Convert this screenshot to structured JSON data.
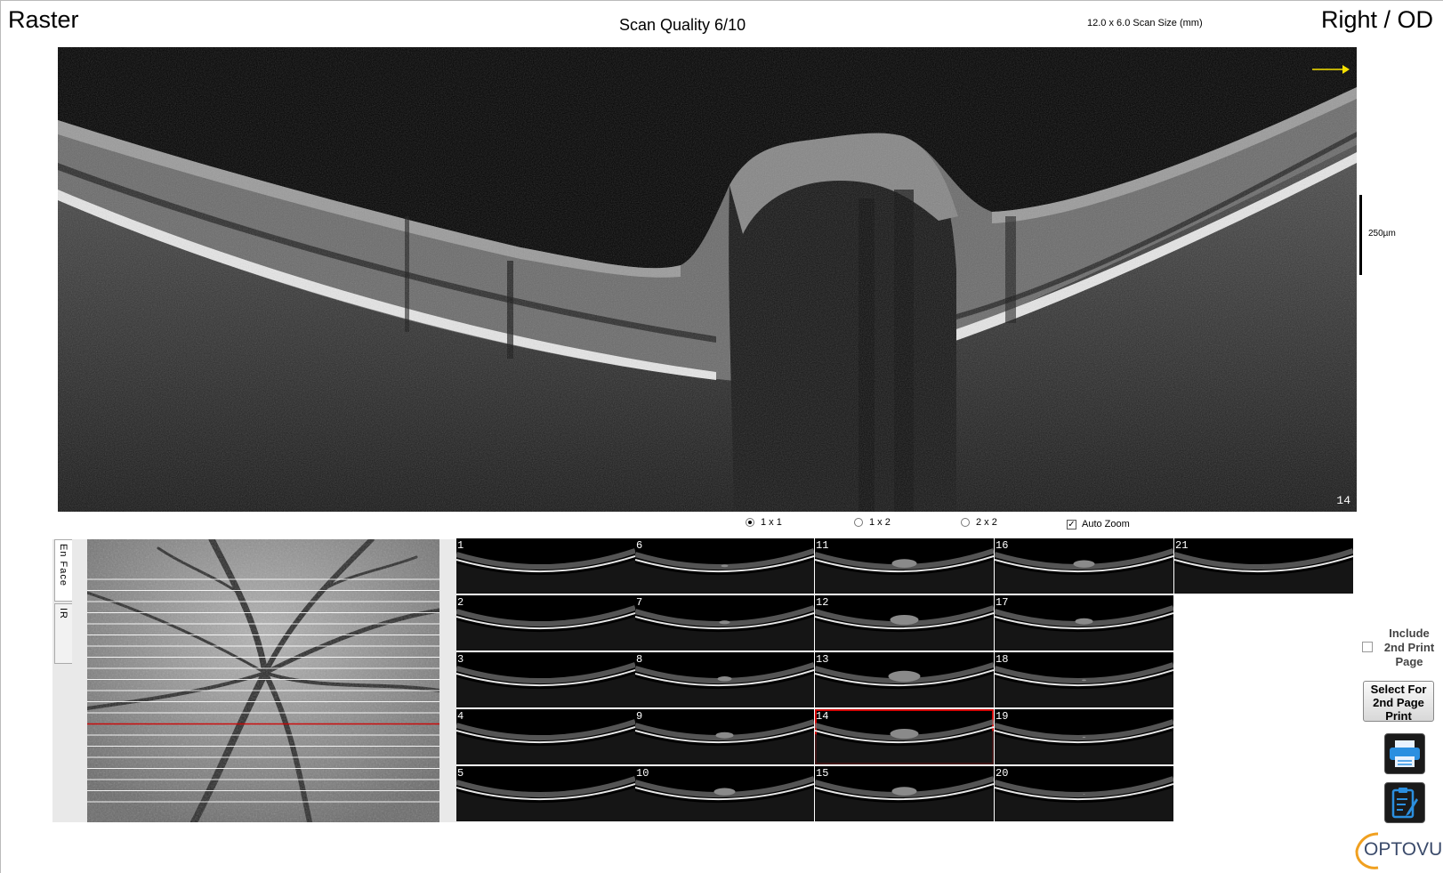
{
  "header": {
    "scan_type": "Raster",
    "quality": "Scan Quality 6/10",
    "scan_size": "12.0 x 6.0 Scan Size (mm)",
    "eye": "Right / OD"
  },
  "main_scan": {
    "scale_label": "250µm",
    "scan_number": "14",
    "arrow_color": "#f5e000"
  },
  "layout_options": [
    {
      "label": "1 x 1",
      "selected": true
    },
    {
      "label": "1 x 2",
      "selected": false
    },
    {
      "label": "2 x 2",
      "selected": false
    }
  ],
  "auto_zoom": {
    "label": "Auto Zoom",
    "checked": true
  },
  "tabs": [
    {
      "label": "En Face"
    },
    {
      "label": "IR"
    }
  ],
  "fundus": {
    "selected_line": 14,
    "line_count": 21,
    "selected_line_color": "#d10000"
  },
  "thumbnails": [
    "1",
    "2",
    "3",
    "4",
    "5",
    "6",
    "7",
    "8",
    "9",
    "10",
    "11",
    "12",
    "13",
    "14",
    "15",
    "16",
    "17",
    "18",
    "19",
    "20",
    "21"
  ],
  "selected_thumbnail": "14",
  "print_panel": {
    "include_label_1": "Include",
    "include_label_2": "2nd Print",
    "include_label_3": "Page",
    "select_btn_1": "Select For",
    "select_btn_2": "2nd Page",
    "select_btn_3": "Print",
    "print_icon": "printer-icon",
    "report_icon": "clipboard-edit-icon"
  },
  "logo_text": "OPTOVUE"
}
